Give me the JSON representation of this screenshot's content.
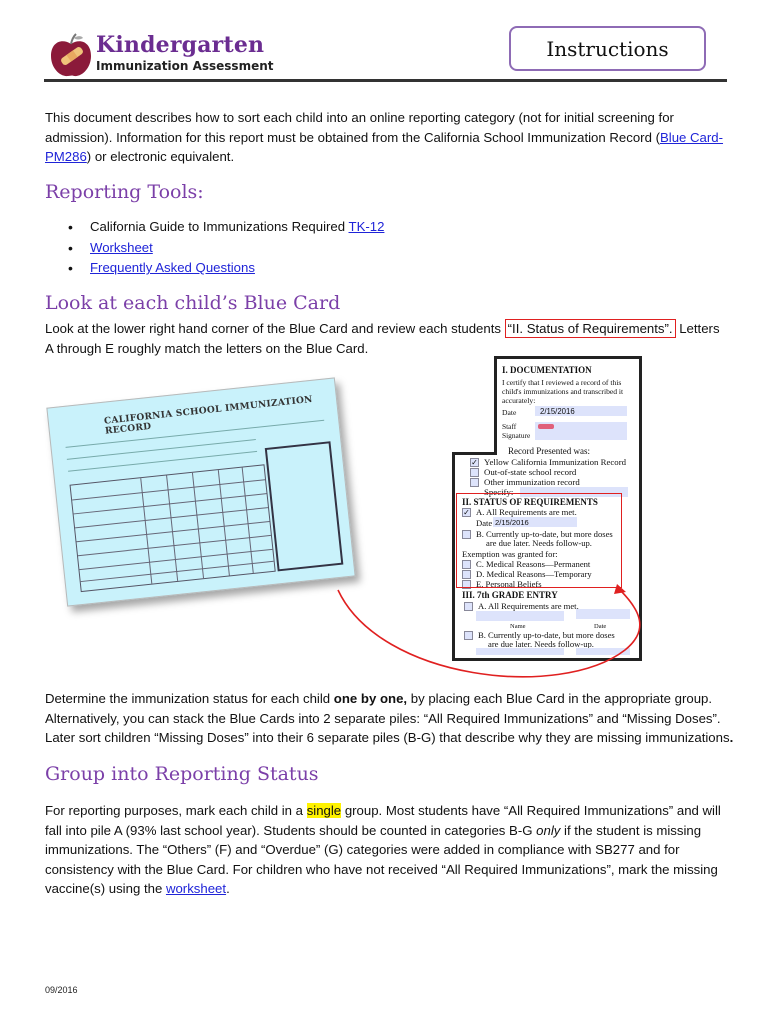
{
  "header": {
    "logo_title": "Kindergarten",
    "logo_subtitle": "Immunization Assessment",
    "section_label": "Instructions"
  },
  "intro": {
    "text_before": "This document describes how to sort each child into an online reporting category (not for initial screening for admission).  Information for this report must be obtained from the California School Immunization Record (",
    "link": "Blue Card-PM286",
    "text_after": ") or electronic equivalent."
  },
  "reporting_tools": {
    "heading": "Reporting Tools:",
    "items": [
      {
        "text": "California Guide to Immunizations Required ",
        "link": "TK-12"
      },
      {
        "text": "",
        "link": "Worksheet"
      },
      {
        "text": "",
        "link": "Frequently Asked Questions"
      }
    ]
  },
  "blue_card_section": {
    "heading": "Look at each child’s Blue Card",
    "text_before": "Look at the lower right hand corner of the Blue Card and review each students ",
    "highlighted": "“II. Status of Requirements”.",
    "text_after": " Letters A through E roughly match the letters on the Blue Card.",
    "card_image": {
      "title": "CALIFORNIA SCHOOL IMMUNIZATION RECORD"
    },
    "detail": {
      "doc_heading": "I. DOCUMENTATION",
      "certify": [
        "I certify that I reviewed a record of this",
        "child's immunizations and transcribed it",
        "accurately:"
      ],
      "date_label": "Date",
      "date_value": "2/15/2016",
      "staff_label": "Staff",
      "signature_label": "Signature",
      "record_presented": "Record Presented was:",
      "records": [
        {
          "label": "Yellow California Immunization Record",
          "checked": true
        },
        {
          "label": "Out-of-state school record",
          "checked": false
        },
        {
          "label": "Other immunization record",
          "checked": false
        }
      ],
      "specify_label": "Specify:",
      "status_heading": "II.  STATUS OF REQUIREMENTS",
      "status_a": "A. All Requirements are met.",
      "status_a_checked": true,
      "status_date_label": "Date",
      "status_date_value": "2/15/2016",
      "status_b": [
        "B. Currently up-to-date, but more doses",
        "are due later.  Needs follow-up."
      ],
      "exemption_label": "Exemption was granted for:",
      "exemptions": [
        "C. Medical Reasons—Permanent",
        "D. Medical Reasons—Temporary",
        "E. Personal Beliefs"
      ],
      "grade7_heading": "III.  7th GRADE ENTRY",
      "grade7_a": "A. All Requirements are met.",
      "grade7_b": [
        "B. Currently up-to-date, but more doses",
        "are due later.  Needs follow-up."
      ],
      "name_label": "Name",
      "date_col_label": "Date"
    }
  },
  "determine": {
    "text_before": "Determine the immunization status for each child ",
    "bold": "one by one,",
    "text_after": " by placing each Blue Card in the appropriate group. Alternatively, you can stack the Blue Cards into 2 separate piles: “All Required Immunizations” and “Missing Doses”. Later sort children “Missing Doses” into their 6 separate piles (B-G) that describe why they are missing immunizations",
    "end_bold": "."
  },
  "group_section": {
    "heading": "Group into Reporting Status",
    "text_1": "For reporting purposes, mark each child in a ",
    "highlight": "single",
    "text_2": " group. Most students have “All Required Immunizations” and will fall into pile A (93% last school year). Students should be counted in categories B-G ",
    "italic": "only",
    "text_3": " if the student is missing immunizations.  The “Others” (F)   and “Overdue” (G) categories were added in compliance with SB277 and for consistency with the Blue Card. For children who have not received “All Required Immunizations”, mark the missing vaccine(s) using the ",
    "link": "worksheet",
    "text_4": "."
  },
  "footer": {
    "date": "09/2016"
  }
}
